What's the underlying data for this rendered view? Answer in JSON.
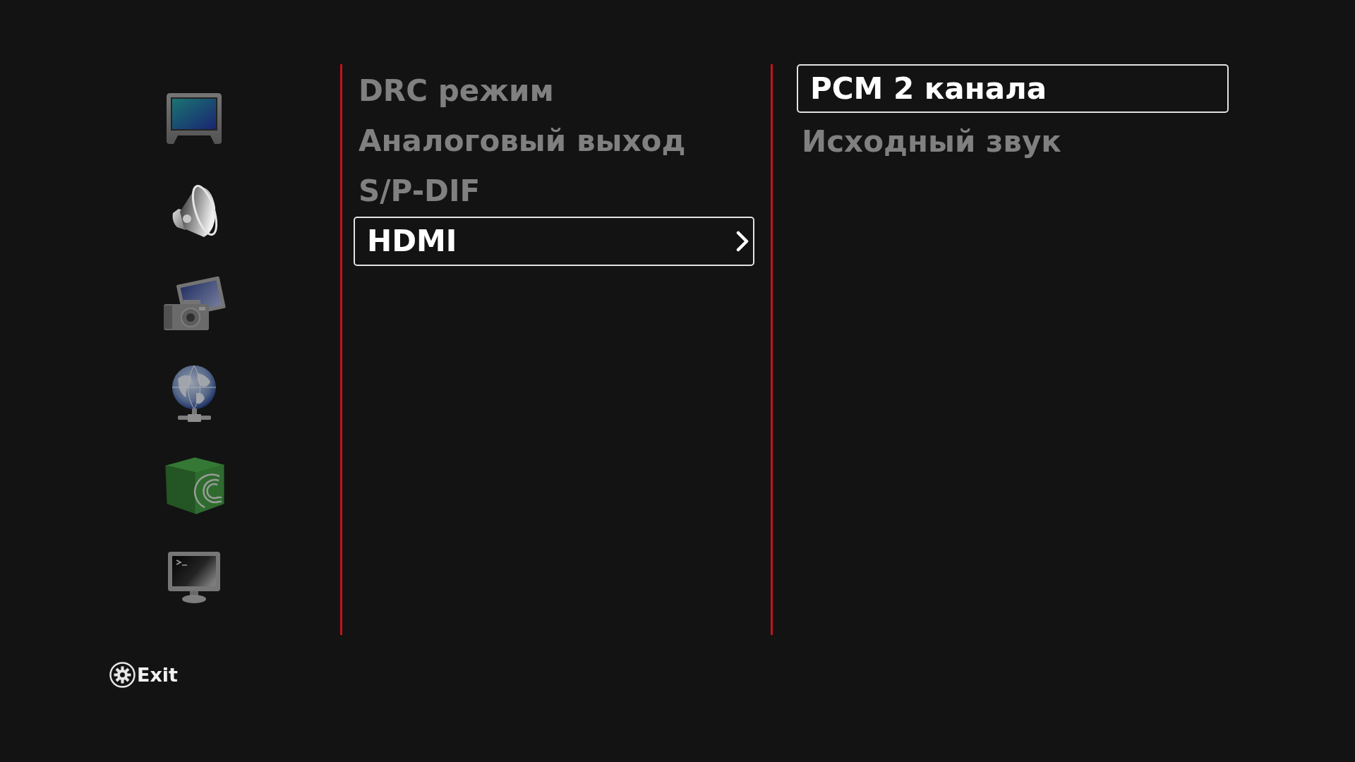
{
  "sidebar": {
    "items": [
      {
        "kind": "display",
        "selected": false
      },
      {
        "kind": "audio",
        "selected": true
      },
      {
        "kind": "photo",
        "selected": false
      },
      {
        "kind": "network",
        "selected": false
      },
      {
        "kind": "torrent",
        "selected": false
      },
      {
        "kind": "system",
        "selected": false
      }
    ]
  },
  "menu": {
    "items": [
      {
        "label": "DRC режим",
        "selected": false,
        "submenu": false
      },
      {
        "label": "Аналоговый выход",
        "selected": false,
        "submenu": false
      },
      {
        "label": "S/P-DIF",
        "selected": false,
        "submenu": false
      },
      {
        "label": "HDMI",
        "selected": true,
        "submenu": true
      }
    ]
  },
  "options": {
    "items": [
      {
        "label": "PCM 2 канала",
        "selected": true
      },
      {
        "label": "Исходный звук",
        "selected": false
      }
    ]
  },
  "footer": {
    "exit_hint": "Exit"
  }
}
